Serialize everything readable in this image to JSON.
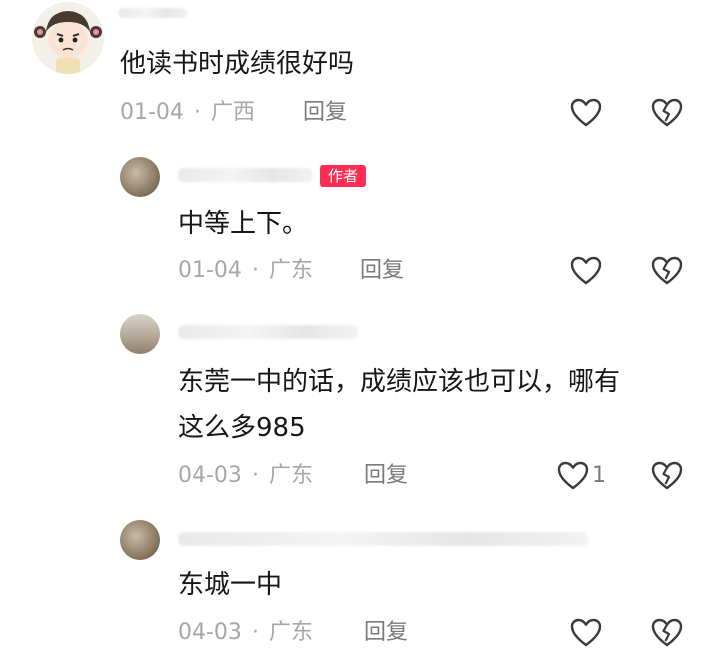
{
  "comments": [
    {
      "text": "他读书时成绩很好吗",
      "date": "01-04",
      "location": "广西",
      "reply_label": "回复",
      "likes": ""
    },
    {
      "author_badge": "作者",
      "text": "中等上下。",
      "date": "01-04",
      "location": "广东",
      "reply_label": "回复",
      "likes": ""
    },
    {
      "text_line1": "东莞一中的话，成绩应该也可以，哪有",
      "text_line2": "这么多985",
      "date": "04-03",
      "location": "广东",
      "reply_label": "回复",
      "likes": "1"
    },
    {
      "text": "东城一中",
      "date": "04-03",
      "location": "广东",
      "reply_label": "回复",
      "likes": ""
    }
  ],
  "separator": "·"
}
